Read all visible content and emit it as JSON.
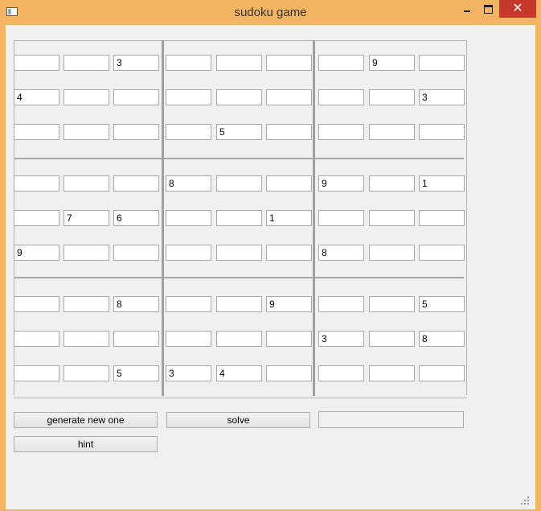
{
  "window": {
    "title": "sudoku game",
    "close_glyph": "✕"
  },
  "grid": {
    "rows": [
      [
        "",
        "",
        "3",
        "",
        "",
        "",
        "",
        "9",
        ""
      ],
      [
        "4",
        "",
        "",
        "",
        "",
        "",
        "",
        "",
        "3"
      ],
      [
        "",
        "",
        "",
        "",
        "5",
        "",
        "",
        "",
        ""
      ],
      [
        "",
        "",
        "",
        "8",
        "",
        "",
        "9",
        "",
        "1"
      ],
      [
        "",
        "7",
        "6",
        "",
        "",
        "1",
        "",
        "",
        ""
      ],
      [
        "9",
        "",
        "",
        "",
        "",
        "",
        "8",
        "",
        ""
      ],
      [
        "",
        "",
        "8",
        "",
        "",
        "9",
        "",
        "",
        "5"
      ],
      [
        "",
        "",
        "",
        "",
        "",
        "",
        "3",
        "",
        "8"
      ],
      [
        "",
        "",
        "5",
        "3",
        "4",
        "",
        "",
        "",
        ""
      ]
    ]
  },
  "controls": {
    "generate_label": "generate new one",
    "solve_label": "solve",
    "hint_label": "hint",
    "status_text": ""
  },
  "icons": {
    "app": "app-icon",
    "minimize": "minimize-icon",
    "maximize": "maximize-icon",
    "close": "close-icon",
    "resize": "resize-grip-icon"
  },
  "colors": {
    "titlebar": "#f4b563",
    "close_button": "#c7372c",
    "window_bg": "#f0f0f0"
  }
}
